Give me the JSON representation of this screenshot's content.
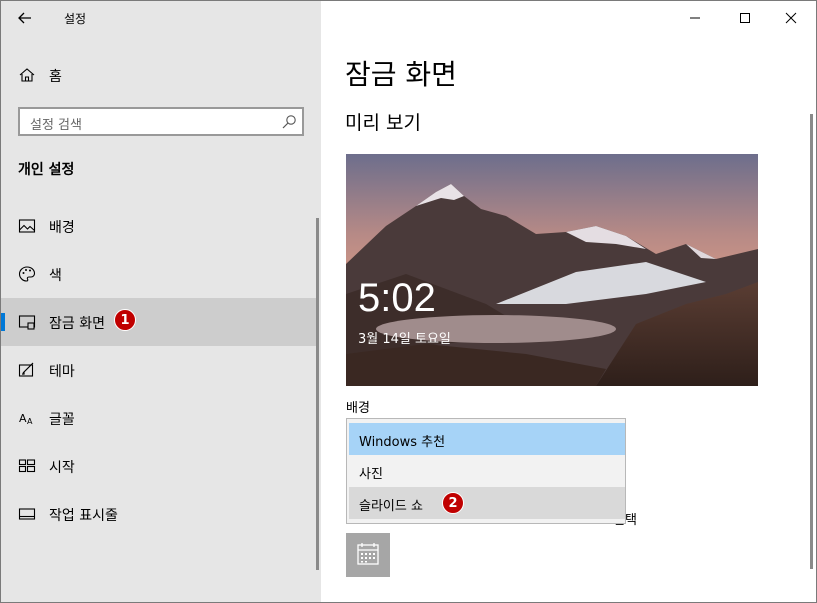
{
  "window": {
    "title": "설정"
  },
  "sidebar": {
    "home_label": "홈",
    "search_placeholder": "설정 검색",
    "section_title": "개인 설정",
    "items": [
      {
        "label": "배경",
        "icon": "image-icon"
      },
      {
        "label": "색",
        "icon": "palette-icon"
      },
      {
        "label": "잠금 화면",
        "icon": "lock-screen-icon",
        "active": true,
        "badge": "1"
      },
      {
        "label": "테마",
        "icon": "theme-icon"
      },
      {
        "label": "글꼴",
        "icon": "font-icon"
      },
      {
        "label": "시작",
        "icon": "start-icon"
      },
      {
        "label": "작업 표시줄",
        "icon": "taskbar-icon"
      }
    ]
  },
  "main": {
    "title": "잠금 화면",
    "preview_heading": "미리 보기",
    "preview_time": "5:02",
    "preview_date": "3월 14일 토요일",
    "background_label": "배경",
    "dropdown_options": [
      {
        "label": "Windows 추천",
        "state": "selected"
      },
      {
        "label": "사진",
        "state": "normal"
      },
      {
        "label": "슬라이드 쇼",
        "state": "hover",
        "badge": "2"
      }
    ],
    "partially_hidden_text": "선택"
  },
  "colors": {
    "sidebar_bg": "#e6e6e6",
    "active_item_bg": "#cdcdcd",
    "accent": "#0078d7",
    "selected_option_bg": "#a6d3f7",
    "badge_red": "#c00000"
  }
}
